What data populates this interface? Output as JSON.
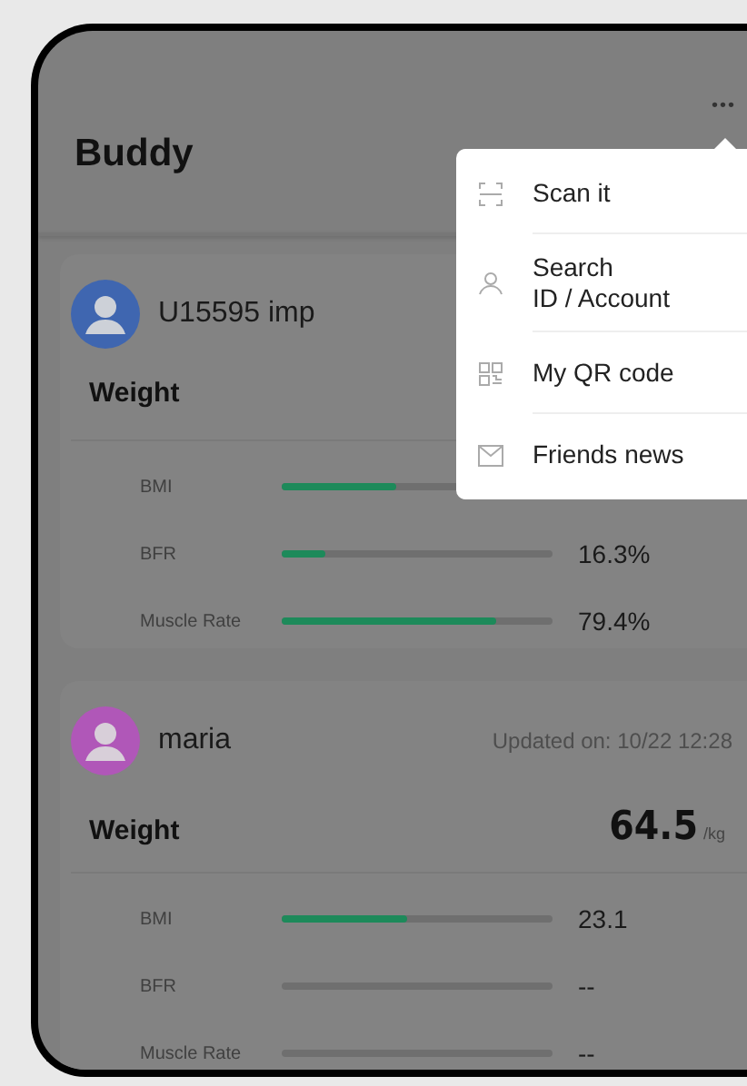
{
  "header": {
    "title": "Buddy",
    "menu_icon": "•••"
  },
  "menu": {
    "items": [
      {
        "kind": "scan",
        "label": "Scan it"
      },
      {
        "kind": "search",
        "label": "Search\nID / Account"
      },
      {
        "kind": "qr",
        "label": "My QR code"
      },
      {
        "kind": "mail",
        "label": "Friends news"
      }
    ]
  },
  "friends": [
    {
      "name": "U15595 imp",
      "color": "#3f66b0",
      "weight_label": "Weight",
      "metrics": [
        {
          "label": "BMI",
          "level": 0.42
        },
        {
          "label": "BFR",
          "level": 0.16,
          "reading": "16.3%"
        },
        {
          "label": "Muscle Rate",
          "level": 0.794,
          "reading": "79.4%"
        }
      ]
    },
    {
      "name": "maria",
      "color": "#b057b8",
      "updated": "Updated on: 10/22 12:28",
      "weight_label": "Weight",
      "weight": "64.5",
      "unit": "/kg",
      "metrics": [
        {
          "label": "BMI",
          "level": 0.46,
          "reading": "23.1"
        },
        {
          "label": "BFR",
          "level": 0,
          "reading": "--"
        },
        {
          "label": "Muscle Rate",
          "level": 0,
          "reading": "--"
        }
      ]
    }
  ]
}
